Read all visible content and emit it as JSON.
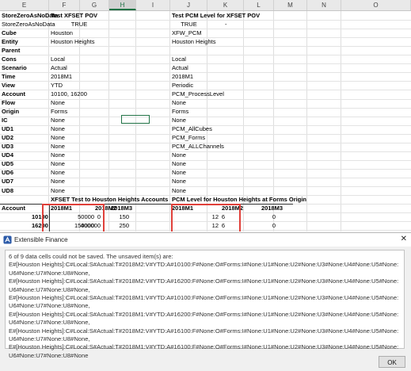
{
  "columns": [
    "E",
    "F",
    "G",
    "H",
    "I",
    "J",
    "K",
    "L",
    "M",
    "N",
    "O"
  ],
  "selected_column": "H",
  "left_block": {
    "header_label": "StoreZeroAsNoData",
    "header_value": "Test XFSET POV",
    "rows": [
      {
        "label": "StoreZeroAsNoData",
        "value": "TRUE",
        "label_bold": false
      },
      {
        "label": "Cube",
        "value": "Houston",
        "label_bold": true
      },
      {
        "label": "Entity",
        "value": "Houston Heights",
        "label_bold": true
      },
      {
        "label": "Parent",
        "value": "",
        "label_bold": true
      },
      {
        "label": "Cons",
        "value": "Local",
        "label_bold": true
      },
      {
        "label": "Scenario",
        "value": "Actual",
        "label_bold": true
      },
      {
        "label": "Time",
        "value": "2018M1",
        "label_bold": true
      },
      {
        "label": "View",
        "value": "YTD",
        "label_bold": true
      },
      {
        "label": "Account",
        "value": "10100, 16200",
        "label_bold": true
      },
      {
        "label": "Flow",
        "value": "None",
        "label_bold": true
      },
      {
        "label": "Origin",
        "value": "Forms",
        "label_bold": true
      },
      {
        "label": "IC",
        "value": "None",
        "label_bold": true
      },
      {
        "label": "UD1",
        "value": "None",
        "label_bold": true
      },
      {
        "label": "UD2",
        "value": "None",
        "label_bold": true
      },
      {
        "label": "UD3",
        "value": "None",
        "label_bold": true
      },
      {
        "label": "UD4",
        "value": "None",
        "label_bold": true
      },
      {
        "label": "UD5",
        "value": "None",
        "label_bold": true
      },
      {
        "label": "UD6",
        "value": "None",
        "label_bold": true
      },
      {
        "label": "UD7",
        "value": "None",
        "label_bold": true
      },
      {
        "label": "UD8",
        "value": "None",
        "label_bold": true
      }
    ]
  },
  "right_block": {
    "header": "Test PCM Level for XFSET POV",
    "values": [
      "TRUE",
      "XFW_PCM",
      "Houston Heights",
      "",
      "Local",
      "Actual",
      "2018M1",
      "Periodic",
      "PCM_ProcessLevel",
      "None",
      "Forms",
      "None",
      "PCM_AllCubes",
      "PCM_Forms",
      "PCM_ALLChannels",
      "None",
      "None",
      "None",
      "None",
      "None"
    ],
    "dash": "-"
  },
  "table_section": {
    "left_title": "XFSET Test to Houston Heights Accounts",
    "right_title": "PCM Level for Houston Heights at Forms Origin",
    "account_label": "Account",
    "periods": [
      "2018M1",
      "2018M2",
      "2018M3"
    ],
    "rows": [
      {
        "account": "10100",
        "left": [
          "50000",
          "0",
          "150"
        ],
        "right": [
          "12",
          "6",
          "0"
        ]
      },
      {
        "account": "16200",
        "left": [
          "150000",
          "400000",
          "250"
        ],
        "right": [
          "12",
          "6",
          "0"
        ]
      },
      {
        "account": "69000",
        "left": [
          "100000",
          "100000",
          "0"
        ],
        "right": [
          "12",
          "6",
          "0"
        ]
      }
    ]
  },
  "notes": {
    "expected": "Expected result is that PCM_User_1 should be blocked from exporting to January and February.  March data should be accepted.",
    "sample": "Sample error result when sheet is submitted:"
  },
  "dialog": {
    "icon": "extensible-finance-logo-icon",
    "title": "Extensible Finance",
    "close_glyph": "✕",
    "message": "6 of 9 data cells could not be saved. The unsaved item(s) are:\nE#[Houston Heights]:C#Local:S#Actual:T#2018M2:V#YTD:A#10100:F#None:O#Forms:I#None:U1#None:U2#None:U3#None:U4#None:U5#None:U6#None:U7#None:U8#None,\nE#[Houston Heights]:C#Local:S#Actual:T#2018M2:V#YTD:A#16200:F#None:O#Forms:I#None:U1#None:U2#None:U3#None:U4#None:U5#None:U6#None:U7#None:U8#None,\nE#[Houston Heights]:C#Local:S#Actual:T#2018M1:V#YTD:A#10100:F#None:O#Forms:I#None:U1#None:U2#None:U3#None:U4#None:U5#None:U6#None:U7#None:U8#None,\nE#[Houston Heights]:C#Local:S#Actual:T#2018M1:V#YTD:A#16200:F#None:O#Forms:I#None:U1#None:U2#None:U3#None:U4#None:U5#None:U6#None:U7#None:U8#None,\nE#[Houston Heights]:C#Local:S#Actual:T#2018M2:V#YTD:A#16100:F#None:O#Forms:I#None:U1#None:U2#None:U3#None:U4#None:U5#None:U6#None:U7#None:U8#None,\nE#[Houston Heights]:C#Local:S#Actual:T#2018M1:V#YTD:A#16100:F#None:O#Forms:I#None:U1#None:U2#None:U3#None:U4#None:U5#None:U6#None:U7#None:U8#None",
    "ok_label": "OK"
  },
  "colors": {
    "highlight_box": "#e0403a",
    "selection": "#217346",
    "dialog_bg": "#f0f0f0"
  }
}
